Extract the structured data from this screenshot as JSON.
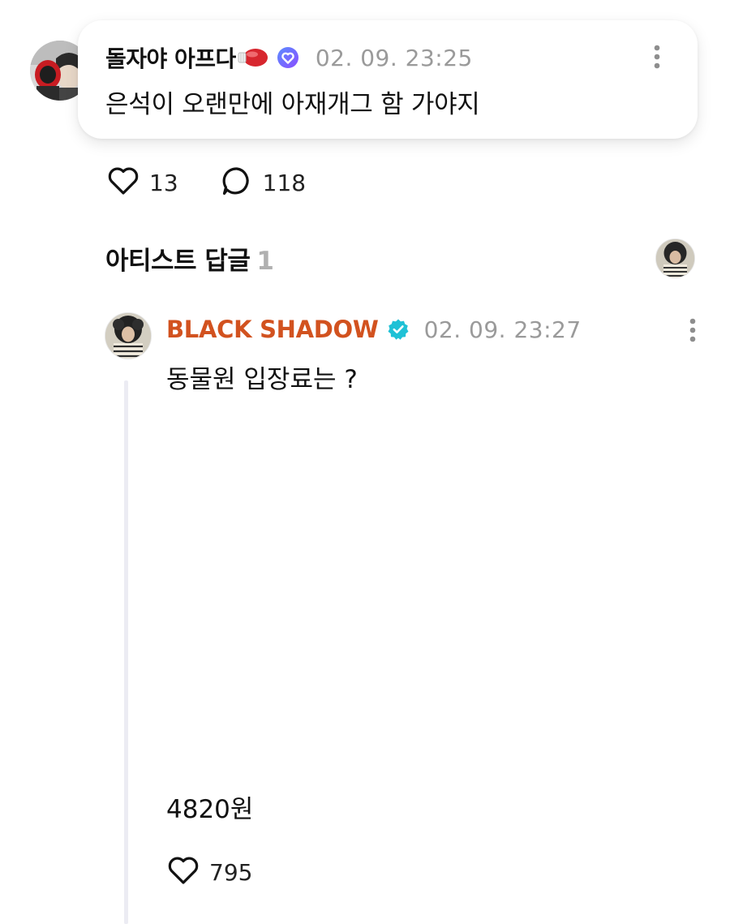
{
  "fan_comment": {
    "author_name": "돌자야 아프다",
    "author_emoji_icon": "boxing-glove-icon",
    "badge_icon": "membership-heart-badge-icon",
    "timestamp": "02. 09. 23:25",
    "text": "은석이 오랜만에 아재개그 함 가야지",
    "likes": "13",
    "replies": "118"
  },
  "artist_section": {
    "title": "아티스트 답글",
    "count": "1"
  },
  "artist_reply": {
    "author_name": "BLACK SHADOW",
    "verified_icon": "verified-badge-icon",
    "name_color": "#d2521f",
    "timestamp": "02. 09. 23:27",
    "line1": "동물원 입장료는 ?",
    "line2": "4820원",
    "likes": "795"
  },
  "colors": {
    "accent_artist": "#d2521f",
    "verified_teal": "#1fc1d6",
    "timestamp_gray": "#9a9a9a",
    "count_gray": "#b0b0b0",
    "thread_line": "#ececf3"
  }
}
